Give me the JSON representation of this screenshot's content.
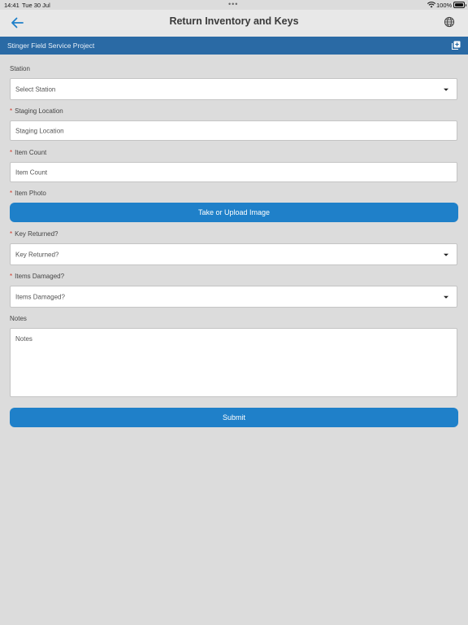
{
  "status_bar": {
    "time": "14:41",
    "date": "Tue 30 Jul",
    "battery": "100%"
  },
  "header": {
    "title": "Return Inventory and Keys",
    "back_icon": "arrow-left-icon",
    "globe_icon": "globe-icon"
  },
  "project": {
    "name": "Stinger Field Service Project",
    "add_icon": "add-square-icon"
  },
  "form": {
    "station": {
      "label": "Station",
      "placeholder": "Select Station"
    },
    "staging_location": {
      "required": "*",
      "label": "Staging Location",
      "placeholder": "Staging Location"
    },
    "item_count": {
      "required": "*",
      "label": "Item Count",
      "placeholder": "Item Count"
    },
    "item_photo": {
      "required": "*",
      "label": "Item Photo",
      "button": "Take or Upload Image"
    },
    "key_returned": {
      "required": "*",
      "label": "Key Returned?",
      "placeholder": "Key Returned?"
    },
    "items_damaged": {
      "required": "*",
      "label": "Items Damaged?",
      "placeholder": "Items Damaged?"
    },
    "notes": {
      "label": "Notes",
      "placeholder": "Notes"
    },
    "submit": "Submit"
  },
  "colors": {
    "accent": "#1f80c9",
    "project_bar": "#2a6aa5",
    "required": "#d23a2a",
    "background": "#dcdcdc"
  }
}
